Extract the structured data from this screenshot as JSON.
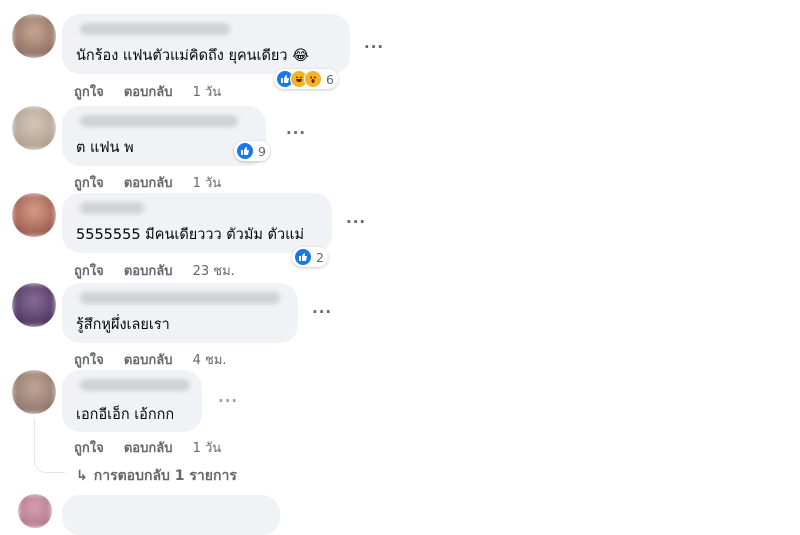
{
  "comments": [
    {
      "text": "นักร้อง แฟนตัวแม่คิดถึง ยุคนเดียว 😂",
      "reaction_count": "6",
      "like": "ถูกใจ",
      "reply": "ตอบกลับ",
      "time": "1 วัน"
    },
    {
      "text": "ต แฟน พ",
      "reaction_count": "9",
      "like": "ถูกใจ",
      "reply": "ตอบกลับ",
      "time": "1 วัน"
    },
    {
      "text": "5555555 มีคนเดียววว ตัวมัม ตัวแม่",
      "reaction_count": "2",
      "like": "ถูกใจ",
      "reply": "ตอบกลับ",
      "time": "23 ชม."
    },
    {
      "text": "รู้สึกหูผึ่งเลยเรา",
      "like": "ถูกใจ",
      "reply": "ตอบกลับ",
      "time": "4 ชม."
    },
    {
      "text": "เอกอีเอ็ก เอ้กกก",
      "like": "ถูกใจ",
      "reply": "ตอบกลับ",
      "time": "1 วัน"
    }
  ],
  "more_options": "···",
  "replies_arrow": "↳",
  "replies_link": "การตอบกลับ 1 รายการ",
  "colors": {
    "like_blue": "#1877f2",
    "bubble_bg": "#f0f2f5",
    "meta_gray": "#65676b"
  }
}
